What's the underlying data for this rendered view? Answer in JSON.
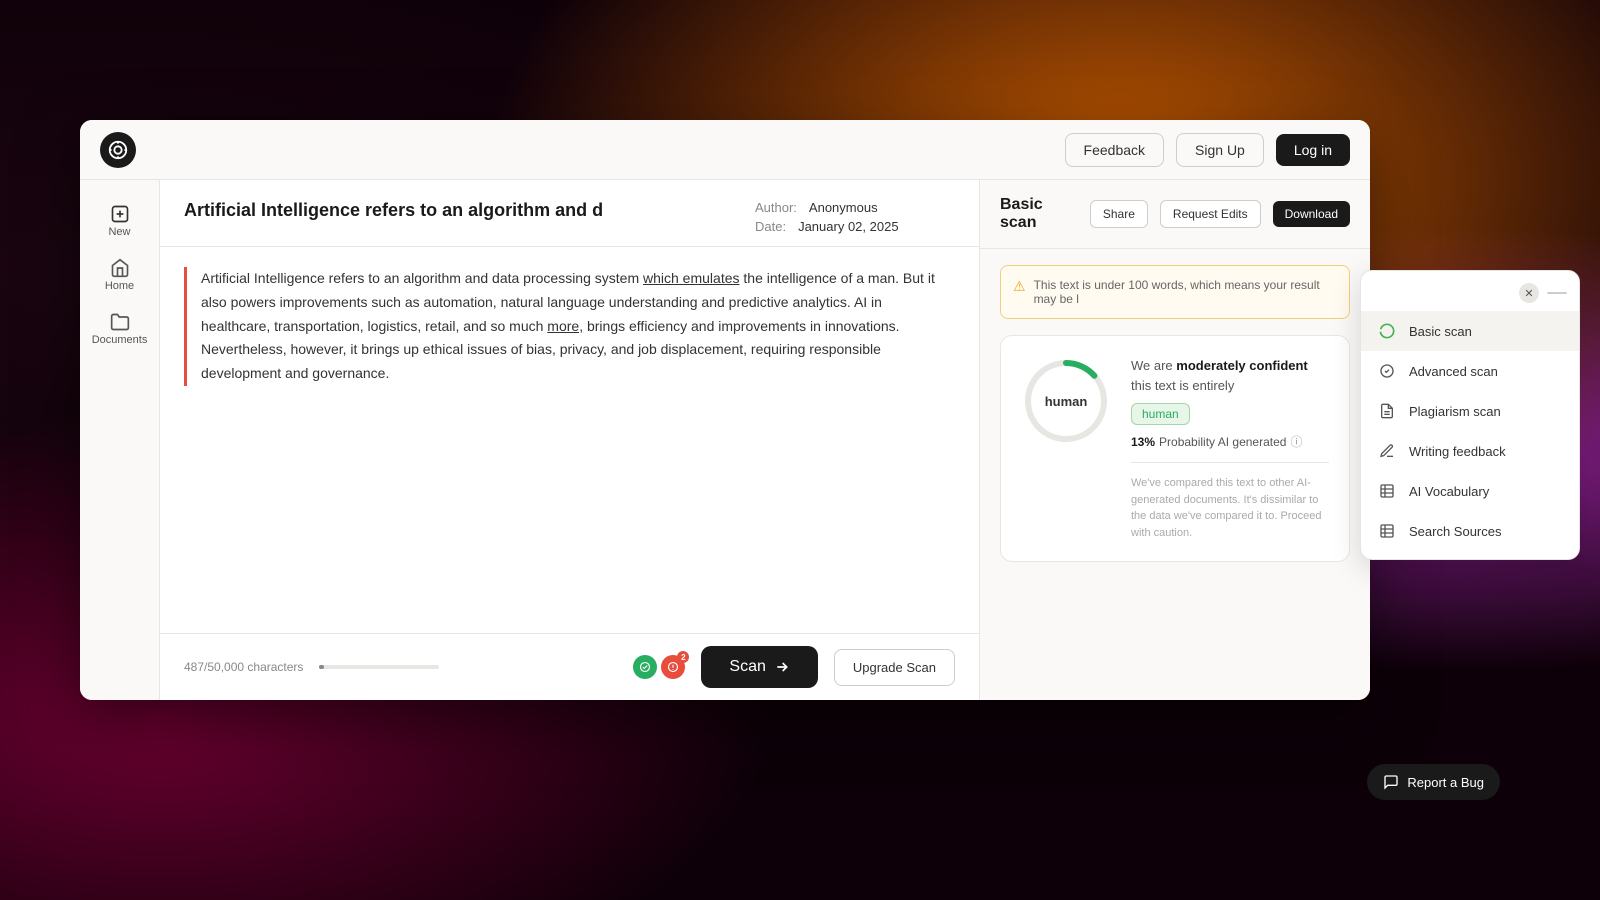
{
  "app": {
    "logo": "©",
    "nav": {
      "feedback_label": "Feedback",
      "signup_label": "Sign Up",
      "login_label": "Log in"
    }
  },
  "sidebar": {
    "new_label": "New",
    "home_label": "Home",
    "documents_label": "Documents"
  },
  "document": {
    "title": "Artificial Intelligence refers to an algorithm and d",
    "author_label": "Author:",
    "author_value": "Anonymous",
    "date_label": "Date:",
    "date_value": "January 02, 2025",
    "body_text": "Artificial Intelligence refers to an algorithm and data processing system which emulates the intelligence of a man. But it also powers improvements such as automation, natural language understanding and predictive analytics. AI in healthcare, transportation, logistics, retail, and so much more, brings efficiency and improvements in innovations. Nevertheless, however, it brings up ethical issues of bias, privacy, and job displacement, requiring responsible development and governance.",
    "char_count": "487/50,000 characters",
    "scan_label": "Scan",
    "upgrade_label": "Upgrade Scan"
  },
  "results": {
    "title": "Basic scan",
    "share_label": "Share",
    "request_edits_label": "Request Edits",
    "download_label": "Download",
    "warning": "This text is under 100 words, which means your result may be l",
    "confidence_text": "We are",
    "confidence_level": "moderately confident",
    "confidence_suffix": "this text is entirely",
    "tag": "human",
    "probability_prefix": "13%",
    "probability_label": "Probability AI generated",
    "compare_text": "We've compared this text to other AI-generated documents. It's dissimilar to the data we've compared it to. Proceed with caution."
  },
  "dropdown": {
    "items": [
      {
        "id": "basic-scan",
        "label": "Basic scan",
        "active": true
      },
      {
        "id": "advanced-scan",
        "label": "Advanced scan",
        "active": false
      },
      {
        "id": "plagiarism-scan",
        "label": "Plagiarism scan",
        "active": false
      },
      {
        "id": "writing-feedback",
        "label": "Writing feedback",
        "active": false
      },
      {
        "id": "ai-vocabulary",
        "label": "AI Vocabulary",
        "active": false
      },
      {
        "id": "search-sources",
        "label": "Search Sources",
        "active": false
      }
    ]
  },
  "report_bug": {
    "label": "Report a Bug"
  }
}
